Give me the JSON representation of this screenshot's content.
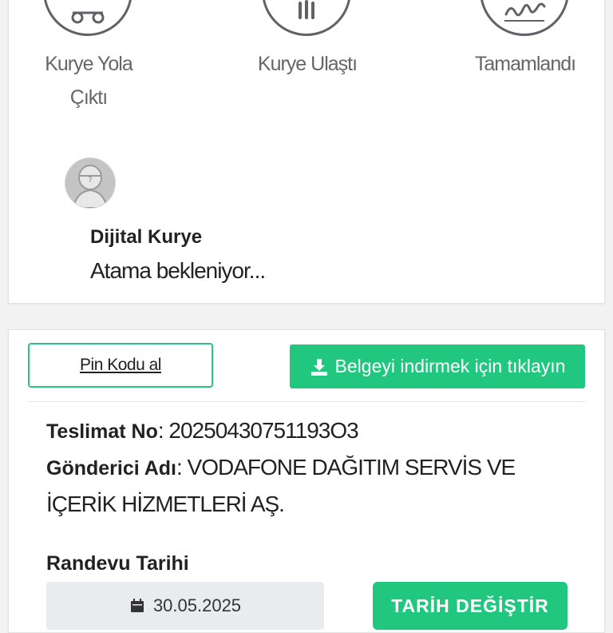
{
  "status": {
    "steps": [
      {
        "label_line1": "Kurye Yola",
        "label_line2": "Çıktı",
        "icon": "scooter-icon"
      },
      {
        "label_line1": "Kurye Ulaştı",
        "label_line2": "",
        "icon": "building-icon"
      },
      {
        "label_line1": "Tamamlandı",
        "label_line2": "",
        "icon": "signature-icon"
      }
    ],
    "courier": {
      "name": "Dijital Kurye",
      "status": "Atama bekleniyor..."
    }
  },
  "delivery": {
    "pin_button": "Pin Kodu al",
    "download_button": "Belgeyi indirmek için tıklayın",
    "delivery_no_label": "Teslimat No",
    "delivery_no_value": ": 20250430751193O3",
    "sender_label": "Gönderici Adı",
    "sender_value_line1": ": VODAFONE DAĞITIM SERVİS VE",
    "sender_value_line2": "İÇERİK HİZMETLERİ AŞ.",
    "appointment_label": "Randevu Tarihi",
    "appointment_date": "30.05.2025",
    "change_date_button": "TARİH DEĞİŞTİR"
  },
  "colors": {
    "accent": "#22c77f",
    "outline": "#29c47f",
    "icon_gray": "#5f6368"
  }
}
